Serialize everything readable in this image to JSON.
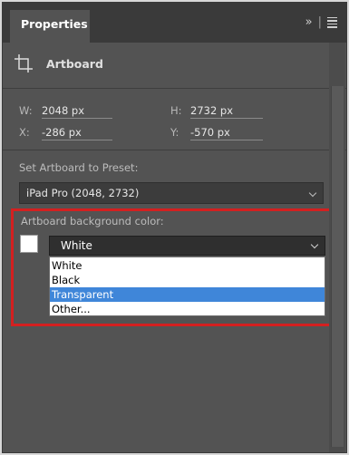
{
  "panel": {
    "tab_label": "Properties",
    "collapse_glyph": "»",
    "separator": "|"
  },
  "section": {
    "title": "Artboard",
    "icon": "artboard-icon"
  },
  "dimensions": {
    "w_label": "W:",
    "w_value": "2048 px",
    "h_label": "H:",
    "h_value": "2732 px",
    "x_label": "X:",
    "x_value": "-286 px",
    "y_label": "Y:",
    "y_value": "-570 px"
  },
  "preset": {
    "label": "Set Artboard to Preset:",
    "value": "iPad Pro (2048, 2732)"
  },
  "background": {
    "label": "Artboard background color:",
    "value": "White",
    "options": [
      {
        "label": "White"
      },
      {
        "label": "Black"
      },
      {
        "label": "Transparent"
      },
      {
        "label": "Other..."
      }
    ],
    "highlighted_option": "Transparent"
  },
  "colors": {
    "panel_bg": "#535353",
    "header_bg": "#3a3a3a",
    "highlight_border": "#d42020",
    "selection_blue": "#3f86d9",
    "swatch": "#ffffff"
  }
}
